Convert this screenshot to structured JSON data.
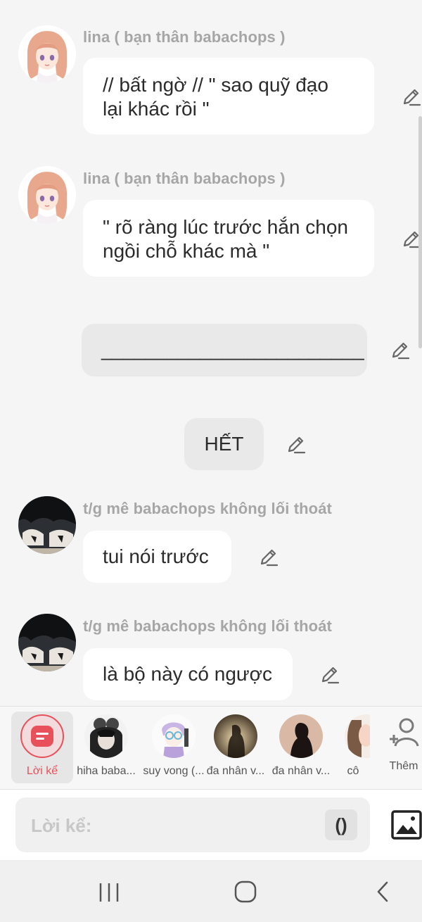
{
  "messages": [
    {
      "sender": "lina ( bạn thân babachops )",
      "lines": [
        "// bất ngờ // \" sao quỹ đạo",
        "lại khác rồi \""
      ]
    },
    {
      "sender": "lina ( bạn thân babachops )",
      "lines": [
        "\" rõ ràng lúc trước hắn chọn",
        "ngồi chỗ khác mà \""
      ]
    },
    {
      "narration": "________________________"
    },
    {
      "end_marker": "HẾT"
    },
    {
      "sender": "t/g mê babachops không lối thoát",
      "text": "tui nói trước"
    },
    {
      "sender": "t/g mê babachops không lối thoát",
      "text": "là bộ này có ngược"
    }
  ],
  "characters": [
    {
      "label": "Lời kể",
      "icon": "narrator-icon",
      "selected": true
    },
    {
      "label": "hiha baba..."
    },
    {
      "label": "suy vong (..."
    },
    {
      "label": "đa nhân v..."
    },
    {
      "label": "đa nhân v..."
    },
    {
      "label": "cô"
    }
  ],
  "add_character": {
    "label": "Thêm",
    "icon": "add-person-icon"
  },
  "input": {
    "placeholder": "Lời kể:",
    "paren_button": "()"
  },
  "icons": {
    "edit": "pencil-icon",
    "image": "image-icon",
    "nav": [
      "recent-apps-icon",
      "home-icon",
      "back-icon"
    ]
  },
  "colors": {
    "background": "#f5f5f5",
    "bubble": "#ffffff",
    "narration_bubble": "#e9e9e9",
    "sender_text": "#a6a6a6",
    "accent": "#e8505b"
  }
}
